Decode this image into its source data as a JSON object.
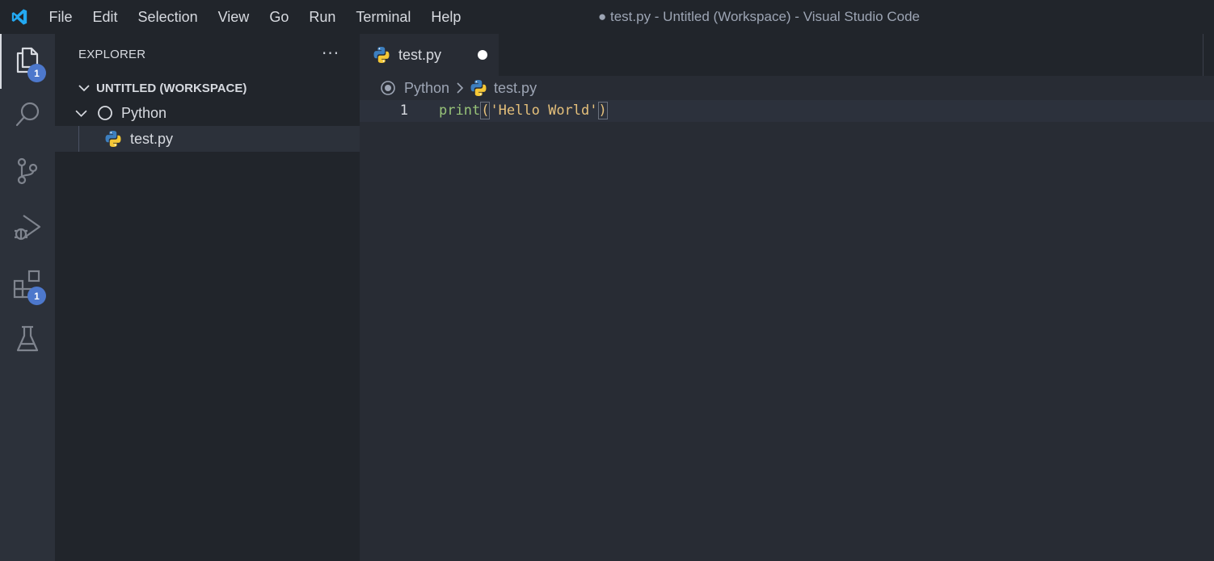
{
  "titlebar": {
    "menu": [
      "File",
      "Edit",
      "Selection",
      "View",
      "Go",
      "Run",
      "Terminal",
      "Help"
    ],
    "window_title": "● test.py - Untitled (Workspace) - Visual Studio Code",
    "logo_icon": "vscode-logo-icon",
    "logo_color": "#23a9f2"
  },
  "activitybar": {
    "items": [
      {
        "icon": "explorer-icon",
        "badge": "1",
        "active": true
      },
      {
        "icon": "search-icon"
      },
      {
        "icon": "source-control-icon"
      },
      {
        "icon": "run-debug-icon"
      },
      {
        "icon": "extensions-icon",
        "badge": "1"
      },
      {
        "icon": "testing-icon"
      }
    ],
    "badge_color": "#4d78cc"
  },
  "sidebar": {
    "title": "EXPLORER",
    "more": "···",
    "workspace": "UNTITLED (WORKSPACE)",
    "tree": [
      {
        "label": "Python",
        "icon": "folder-circle-icon",
        "expanded": true
      },
      {
        "label": "test.py",
        "icon": "python-file-icon",
        "selected": true
      }
    ]
  },
  "editor": {
    "tab": {
      "label": "test.py",
      "icon": "python-file-icon",
      "dirty": true
    },
    "breadcrumb": [
      "Python",
      "test.py"
    ],
    "lines": [
      {
        "number": "1",
        "fn": "print",
        "open": "(",
        "string": "'Hello World'",
        "close": ")"
      }
    ],
    "colors": {
      "function": "#98c379",
      "string": "#e5c07b"
    }
  }
}
